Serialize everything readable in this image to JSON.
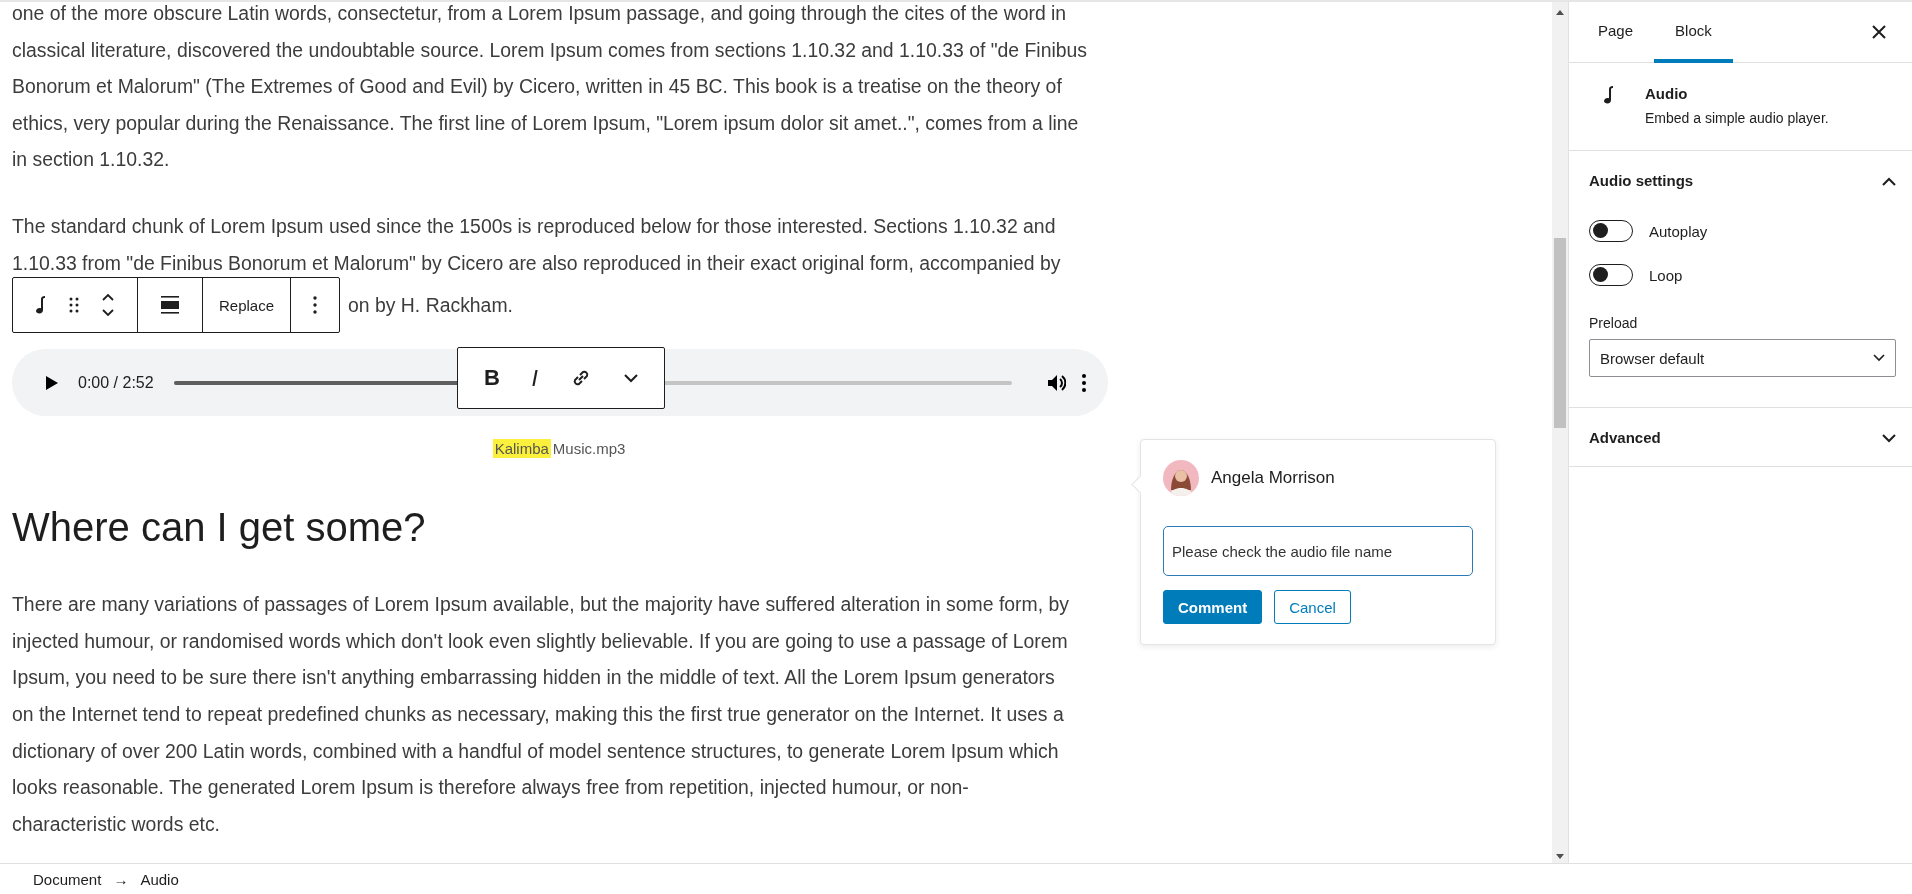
{
  "content": {
    "paragraph_1": {
      "lines": [
        "one of the more obscure Latin words, consectetur, from a Lorem Ipsum passage, and going through the cites of the word in",
        "classical literature, discovered the undoubtable source. Lorem Ipsum comes from sections 1.10.32 and 1.10.33 of \"de Finibus",
        "Bonorum et Malorum\" (The Extremes of Good and Evil) by Cicero, written in 45 BC. This book is a treatise on the theory of",
        "ethics, very popular during the Renaissance. The first line of Lorem Ipsum, \"Lorem ipsum dolor sit amet..\", comes from a line",
        "in section 1.10.32."
      ]
    },
    "paragraph_2": {
      "lines": [
        "The standard chunk of Lorem Ipsum used since the 1500s is reproduced below for those interested. Sections 1.10.32 and",
        "1.10.33 from \"de Finibus Bonorum et Malorum\" by Cicero are also reproduced in their exact original form, accompanied by"
      ],
      "partly_covered_line": "on by H. Rackham."
    },
    "block_toolbar": {
      "replace_label": "Replace"
    },
    "audio_player": {
      "time": "0:00 / 2:52",
      "level": 0.4
    },
    "format_toolbar": {
      "bold_label": "B",
      "italic_label": "I"
    },
    "caption": {
      "segments": [
        {
          "text": "Kalimba",
          "highlighted": true
        },
        {
          "text": "Music.mp3",
          "highlighted": false
        }
      ]
    },
    "heading": "Where can I get some?",
    "paragraph_3": {
      "lines": [
        "There are many variations of passages of Lorem Ipsum available, but the majority have suffered alteration in some form, by",
        "injected humour, or randomised words which don't look even slightly believable. If you are going to use a passage of Lorem",
        "Ipsum, you need to be sure there isn't anything embarrassing hidden in the middle of text. All the Lorem Ipsum generators",
        "on the Internet tend to repeat predefined chunks as necessary, making this the first true generator on the Internet. It uses a",
        "dictionary of over 200 Latin words, combined with a handful of model sentence structures, to generate Lorem Ipsum which",
        "looks reasonable. The generated Lorem Ipsum is therefore always free from repetition, injected humour, or non-",
        "characteristic words etc."
      ]
    }
  },
  "comment": {
    "author": "Angela Morrison",
    "value": "Please check the audio file name",
    "buttons": [
      {
        "label": "Comment",
        "kind": "primary"
      },
      {
        "label": "Cancel",
        "kind": "secondary"
      }
    ]
  },
  "sidebar": {
    "tabs": [
      {
        "label": "Page",
        "selected": false
      },
      {
        "label": "Block",
        "selected": true
      }
    ],
    "block": {
      "title": "Audio",
      "description": "Embed a simple audio player."
    },
    "panels": [
      {
        "title": "Audio settings",
        "expanded": true,
        "toggles": [
          {
            "label": "Autoplay",
            "on": false
          },
          {
            "label": "Loop",
            "on": false
          }
        ],
        "select": {
          "label": "Preload",
          "value": "Browser default"
        }
      },
      {
        "title": "Advanced",
        "expanded": false
      }
    ]
  },
  "breadcrumb": {
    "items": [
      "Document",
      "Audio"
    ],
    "separator": "→"
  }
}
